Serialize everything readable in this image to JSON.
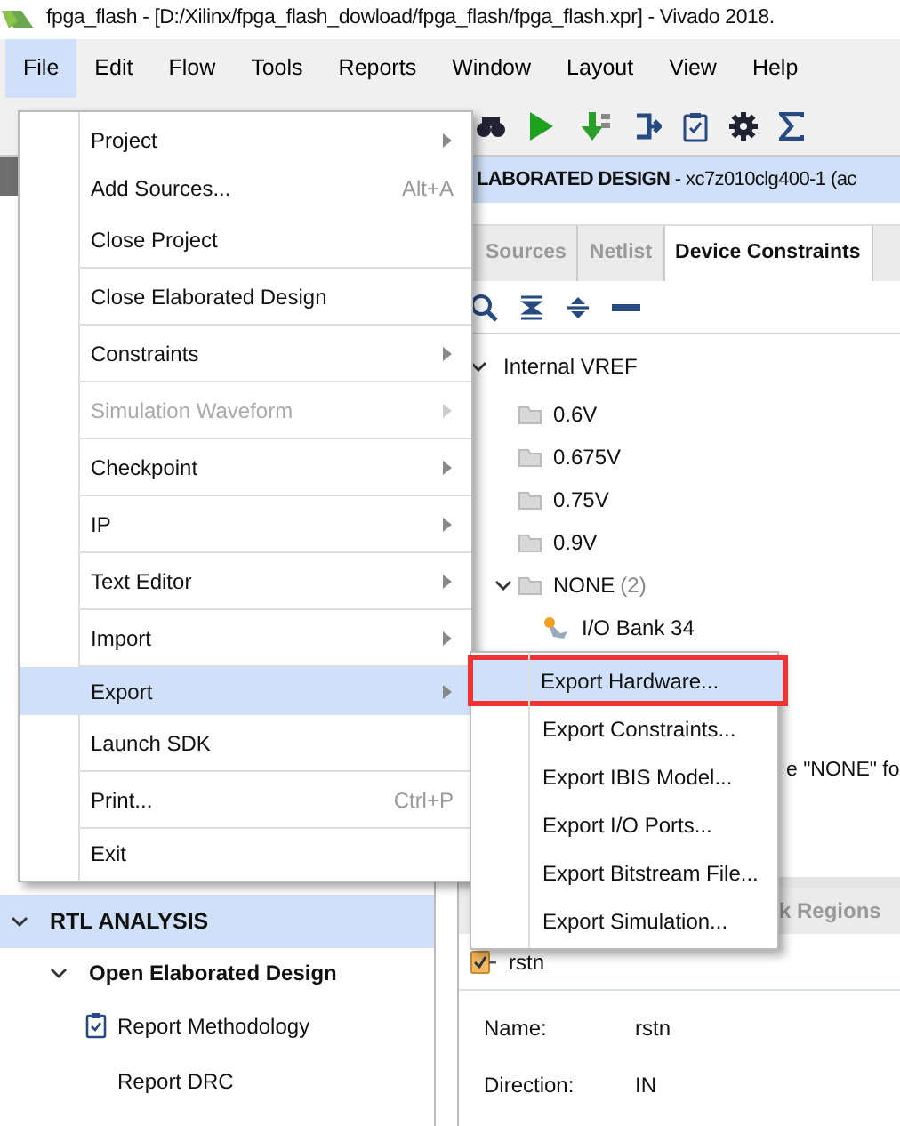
{
  "window": {
    "title": "fpga_flash - [D:/Xilinx/fpga_flash_dowload/fpga_flash/fpga_flash.xpr] - Vivado 2018."
  },
  "menubar": [
    {
      "label": "File",
      "selected": true
    },
    {
      "label": "Edit",
      "selected": false
    },
    {
      "label": "Flow",
      "selected": false
    },
    {
      "label": "Tools",
      "selected": false
    },
    {
      "label": "Reports",
      "selected": false
    },
    {
      "label": "Window",
      "selected": false
    },
    {
      "label": "Layout",
      "selected": false
    },
    {
      "label": "View",
      "selected": false
    },
    {
      "label": "Help",
      "selected": false
    }
  ],
  "flow_navigator": {
    "sections": [
      {
        "label": "RTL ANALYSIS",
        "selected": true,
        "expanded": true,
        "children": [
          {
            "label": "Open Elaborated Design",
            "expanded": true,
            "children": [
              {
                "label": "Report Methodology",
                "kind": "checklist"
              },
              {
                "label": "Report DRC",
                "kind": "plain"
              }
            ]
          }
        ]
      }
    ]
  },
  "design_header": "**LABORATED DESIGN** - xc7z010clg400-1  (ac",
  "tabs": [
    {
      "label": "Sources",
      "selected": false
    },
    {
      "label": "Netlist",
      "selected": false
    },
    {
      "label": "Device Constraints",
      "selected": true
    }
  ],
  "tree": [
    {
      "label": "Internal VREF",
      "expanded": true,
      "children": [
        {
          "label": "0.6V",
          "kind": "folder"
        },
        {
          "label": "0.675V",
          "kind": "folder"
        },
        {
          "label": "0.75V",
          "kind": "folder"
        },
        {
          "label": "0.9V",
          "kind": "folder"
        },
        {
          "label": "NONE",
          "count": "(2)",
          "kind": "folder",
          "expanded": true,
          "children": [
            {
              "label": "I/O Bank 34",
              "kind": "bank"
            }
          ]
        }
      ]
    }
  ],
  "tree_note": "e \"NONE\" fo",
  "properties": {
    "tab": "k Regions",
    "object": "rstn",
    "fields": [
      {
        "label": "Name:",
        "value": "rstn"
      },
      {
        "label": "Direction:",
        "value": "IN"
      }
    ]
  },
  "file_menu": [
    {
      "label": "Project",
      "submenu": true,
      "disabled": false,
      "selected": false,
      "divider_after": false
    },
    {
      "label": "Add Sources...",
      "shortcut": "Alt+A",
      "submenu": false,
      "disabled": false,
      "selected": false,
      "divider_after": false
    },
    {
      "label": "Close Project",
      "submenu": false,
      "disabled": false,
      "selected": false,
      "divider_after": true
    },
    {
      "label": "Close Elaborated Design",
      "submenu": false,
      "disabled": false,
      "selected": false,
      "divider_after": true
    },
    {
      "label": "Constraints",
      "submenu": true,
      "disabled": false,
      "selected": false,
      "divider_after": true
    },
    {
      "label": "Simulation Waveform",
      "submenu": true,
      "disabled": true,
      "selected": false,
      "divider_after": true
    },
    {
      "label": "Checkpoint",
      "submenu": true,
      "disabled": false,
      "selected": false,
      "divider_after": true
    },
    {
      "label": "IP",
      "submenu": true,
      "disabled": false,
      "selected": false,
      "divider_after": true
    },
    {
      "label": "Text Editor",
      "submenu": true,
      "disabled": false,
      "selected": false,
      "divider_after": true
    },
    {
      "label": "Import",
      "submenu": true,
      "disabled": false,
      "selected": false,
      "divider_after": true
    },
    {
      "label": "Export",
      "submenu": true,
      "disabled": false,
      "selected": true,
      "divider_after": false
    },
    {
      "label": "Launch SDK",
      "submenu": false,
      "disabled": false,
      "selected": false,
      "divider_after": true
    },
    {
      "label": "Print...",
      "shortcut": "Ctrl+P",
      "submenu": false,
      "disabled": false,
      "selected": false,
      "divider_after": true
    },
    {
      "label": "Exit",
      "submenu": false,
      "disabled": false,
      "selected": false,
      "divider_after": false
    }
  ],
  "export_submenu": [
    {
      "label": "Export Hardware...",
      "selected": true
    },
    {
      "label": "Export Constraints...",
      "selected": false
    },
    {
      "label": "Export IBIS Model...",
      "selected": false
    },
    {
      "label": "Export I/O Ports...",
      "selected": false
    },
    {
      "label": "Export Bitstream File...",
      "selected": false
    },
    {
      "label": "Export Simulation...",
      "selected": false
    }
  ]
}
